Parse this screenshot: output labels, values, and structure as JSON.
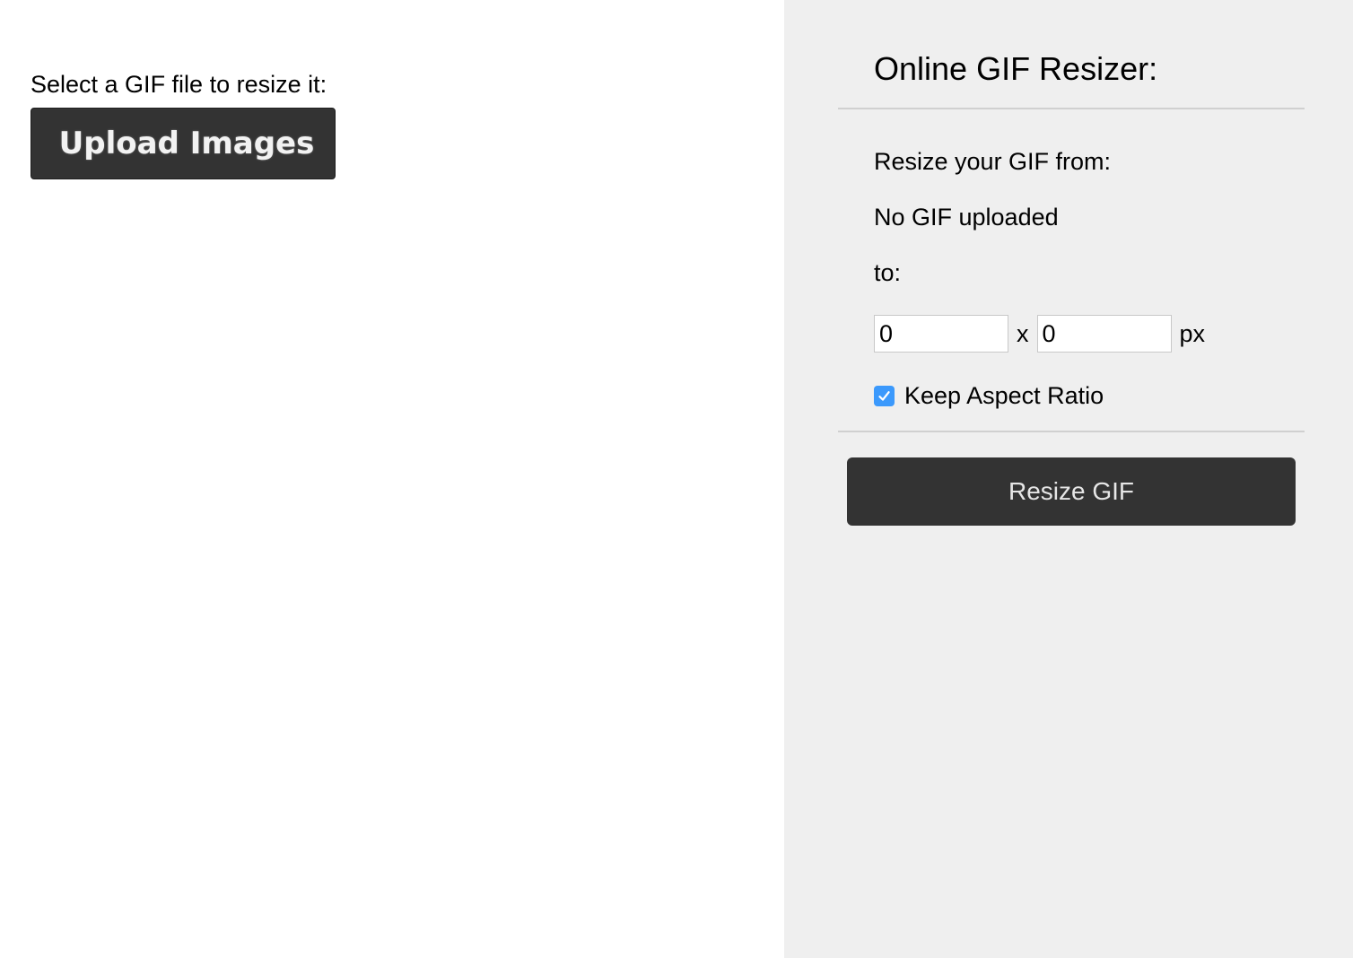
{
  "upload_section": {
    "instruction": "Select a GIF file to resize it:",
    "upload_button_label": "Upload Images"
  },
  "resizer_panel": {
    "title": "Online GIF Resizer:",
    "resize_from_label": "Resize your GIF from:",
    "current_size": "No GIF uploaded",
    "to_label": "to:",
    "width_value": "0",
    "times_sign": "x",
    "height_value": "0",
    "unit": "px",
    "keep_aspect_ratio": {
      "label": "Keep Aspect Ratio",
      "checked": true
    },
    "resize_button_label": "Resize GIF"
  },
  "colors": {
    "button_background": "#333333",
    "panel_background": "#efefef",
    "checkbox_accent": "#3b99fc"
  },
  "icons": {
    "checkbox_check": "checkmark-icon"
  }
}
